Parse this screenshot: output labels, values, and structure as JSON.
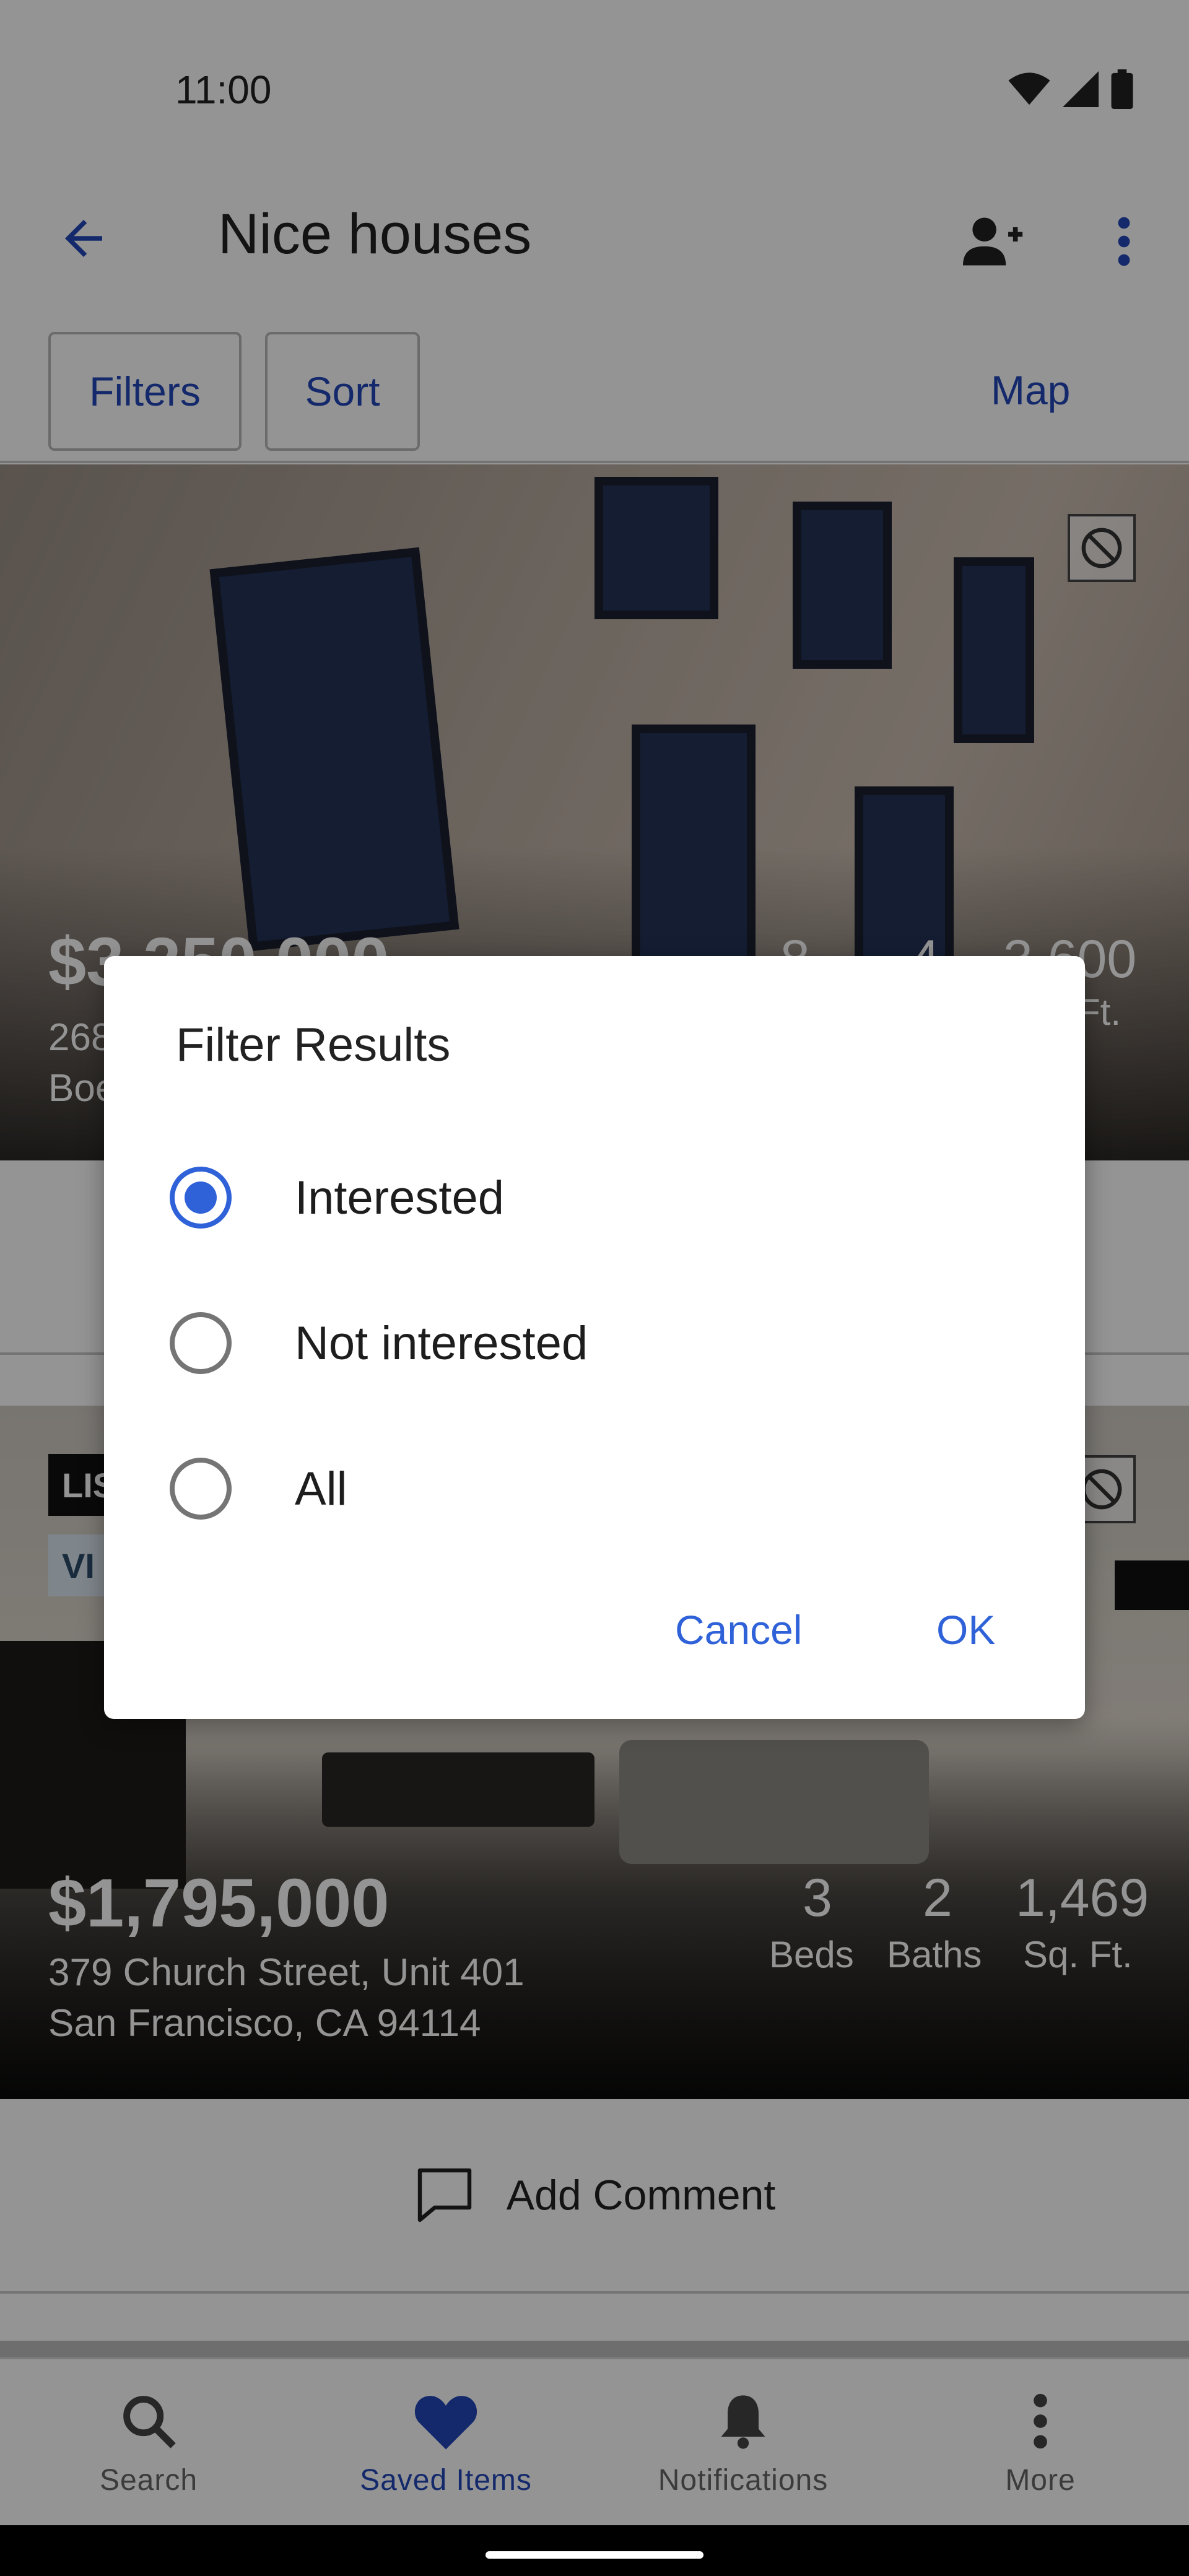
{
  "status_bar": {
    "time": "11:00"
  },
  "app_bar": {
    "title": "Nice houses"
  },
  "toolbar": {
    "filters_label": "Filters",
    "sort_label": "Sort",
    "map_label": "Map"
  },
  "listings": [
    {
      "price": "$3,250,000",
      "address_line1": "268",
      "address_line2": "Boe",
      "beds": "8",
      "baths": "4",
      "sqft": "3,600",
      "sqft_label": "Ft."
    },
    {
      "badge_listed": "LIS",
      "badge_view": "VI",
      "price": "$1,795,000",
      "address_line1": "379 Church Street, Unit 401",
      "address_line2": "San Francisco, CA 94114",
      "beds": "3",
      "beds_label": "Beds",
      "baths": "2",
      "baths_label": "Baths",
      "sqft": "1,469",
      "sqft_label": "Sq. Ft."
    }
  ],
  "add_comment_label": "Add Comment",
  "bottom_nav": {
    "items": [
      {
        "label": "Search",
        "icon": "search-icon"
      },
      {
        "label": "Saved Items",
        "icon": "heart-icon",
        "active": true
      },
      {
        "label": "Notifications",
        "icon": "bell-icon"
      },
      {
        "label": "More",
        "icon": "more-vert-icon"
      }
    ]
  },
  "dialog": {
    "title": "Filter Results",
    "options": [
      {
        "label": "Interested",
        "selected": true
      },
      {
        "label": "Not interested",
        "selected": false
      },
      {
        "label": "All",
        "selected": false
      }
    ],
    "cancel_label": "Cancel",
    "ok_label": "OK"
  },
  "colors": {
    "accent": "#2f62d8",
    "link": "#2447b8"
  }
}
